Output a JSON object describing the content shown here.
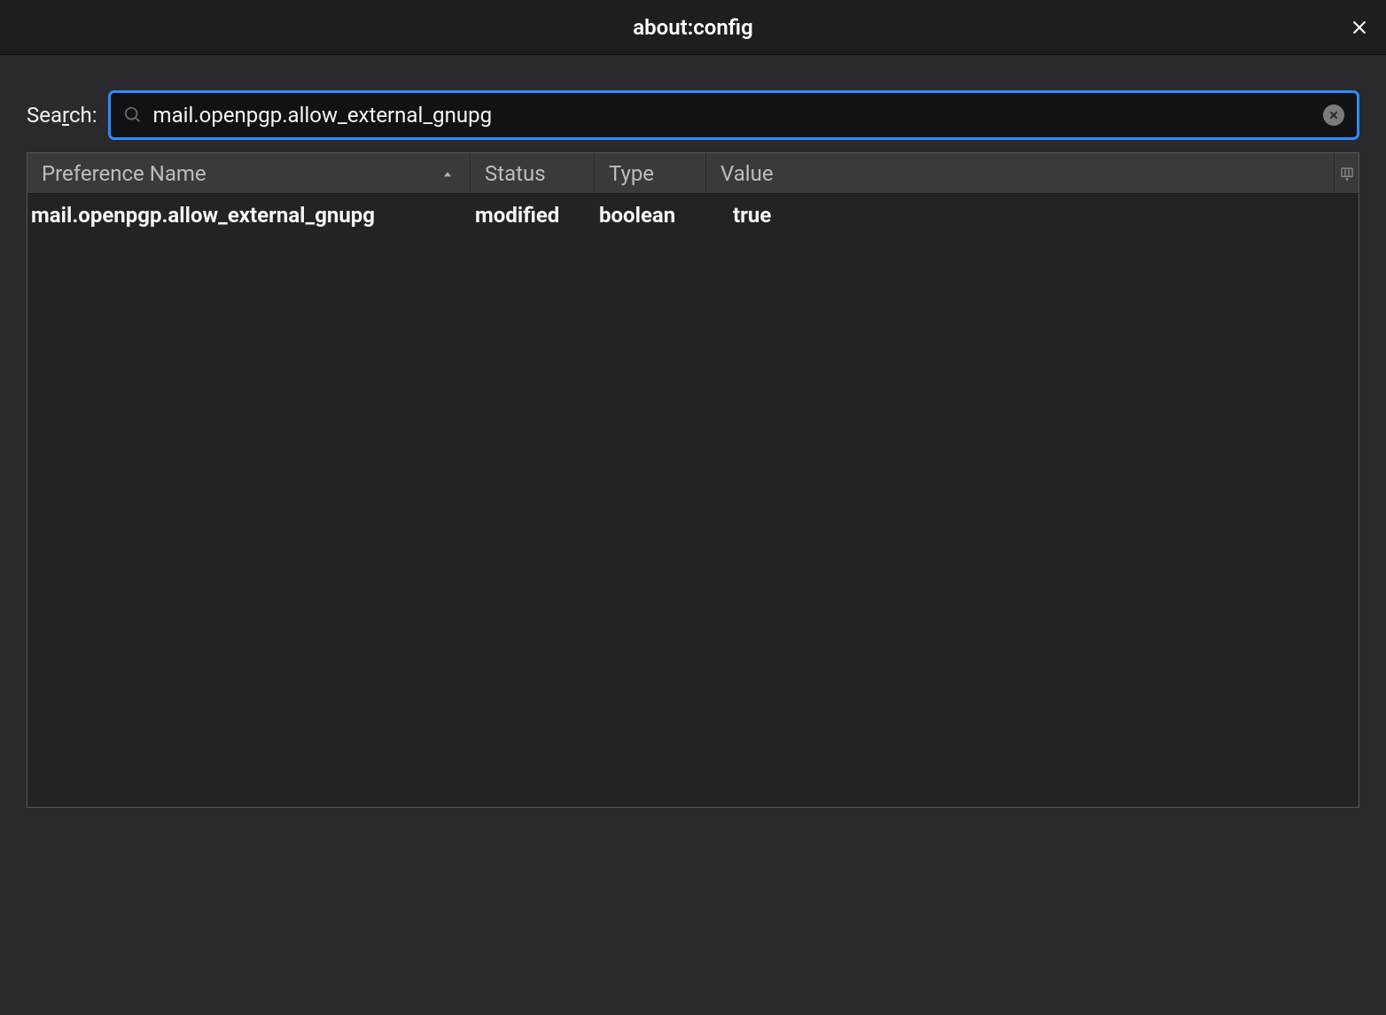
{
  "window": {
    "title": "about:config"
  },
  "search": {
    "label_prefix": "Sea",
    "label_underlined": "r",
    "label_suffix": "ch:",
    "value": "mail.openpgp.allow_external_gnupg",
    "placeholder": ""
  },
  "table": {
    "columns": {
      "name": "Preference Name",
      "status": "Status",
      "type": "Type",
      "value": "Value"
    },
    "rows": [
      {
        "name": "mail.openpgp.allow_external_gnupg",
        "status": "modified",
        "type": "boolean",
        "value": "true"
      }
    ]
  }
}
